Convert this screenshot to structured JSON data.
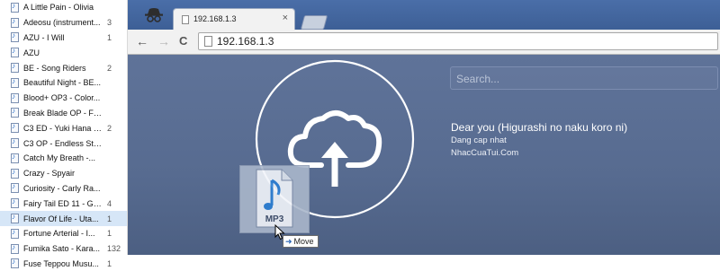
{
  "file_list": [
    {
      "name": "A Little Pain - Olivia",
      "count": ""
    },
    {
      "name": "Adeosu (instrument...",
      "count": "3"
    },
    {
      "name": "AZU - I Will",
      "count": "1"
    },
    {
      "name": "AZU",
      "count": ""
    },
    {
      "name": "BE - Song Riders",
      "count": "2"
    },
    {
      "name": "Beautiful Night - BE...",
      "count": ""
    },
    {
      "name": "Blood+ OP3 - Color...",
      "count": ""
    },
    {
      "name": "Break Blade OP - Fa...",
      "count": ""
    },
    {
      "name": "C3 ED - Yuki Hana -...",
      "count": "2"
    },
    {
      "name": "C3 OP - Endless Sto...",
      "count": ""
    },
    {
      "name": "Catch My Breath -...",
      "count": ""
    },
    {
      "name": "Crazy - Spyair",
      "count": ""
    },
    {
      "name": "Curiosity - Carly Ra...",
      "count": ""
    },
    {
      "name": "Fairy Tail ED 11 - Gli...",
      "count": "4"
    },
    {
      "name": "Flavor Of Life - Uta...",
      "count": "1",
      "selected": true
    },
    {
      "name": "Fortune Arterial - I...",
      "count": "1"
    },
    {
      "name": "Fumika Sato - Kara...",
      "count": "132"
    },
    {
      "name": "Fuse Teppou Musu...",
      "count": "1"
    }
  ],
  "browser": {
    "tab_title": "192.168.1.3",
    "tab_close": "×",
    "address": "192.168.1.3",
    "nav": {
      "back": "←",
      "forward": "→",
      "reload": "C"
    }
  },
  "page": {
    "search_placeholder": "Search...",
    "song_title": "Dear you (Higurashi no naku koro ni)",
    "song_lines": [
      "Dang cap nhat",
      "NhacCuaTui.Com"
    ]
  },
  "drag": {
    "file_label": "MP3",
    "tooltip": "Move",
    "tooltip_arrow": "➜"
  },
  "colors": {
    "browser_frame": "#3d5f96",
    "page_background": "#576b90",
    "selected_row": "#d6e6f7"
  }
}
